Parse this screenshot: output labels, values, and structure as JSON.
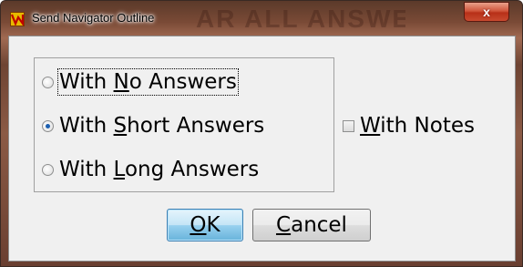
{
  "window": {
    "title": "Send Navigator Outline",
    "background_ghost_text": "AR ALL ANSWE",
    "close_label": "x"
  },
  "options": {
    "radios": [
      {
        "prefix": "With ",
        "mnemonic": "N",
        "suffix": "o Answers",
        "checked": false
      },
      {
        "prefix": "With ",
        "mnemonic": "S",
        "suffix": "hort Answers",
        "checked": true
      },
      {
        "prefix": "With ",
        "mnemonic": "L",
        "suffix": "ong Answers",
        "checked": false
      }
    ],
    "notes_checkbox": {
      "mnemonic": "W",
      "suffix": "ith Notes",
      "checked": false
    }
  },
  "buttons": {
    "ok": {
      "mnemonic": "O",
      "suffix": "K"
    },
    "cancel": {
      "mnemonic": "C",
      "suffix": "ancel"
    }
  },
  "colors": {
    "radio_checked_dot": "#1c5fb0",
    "ok_button_blue": "#98d1ef",
    "close_button_red": "#c84a30"
  }
}
